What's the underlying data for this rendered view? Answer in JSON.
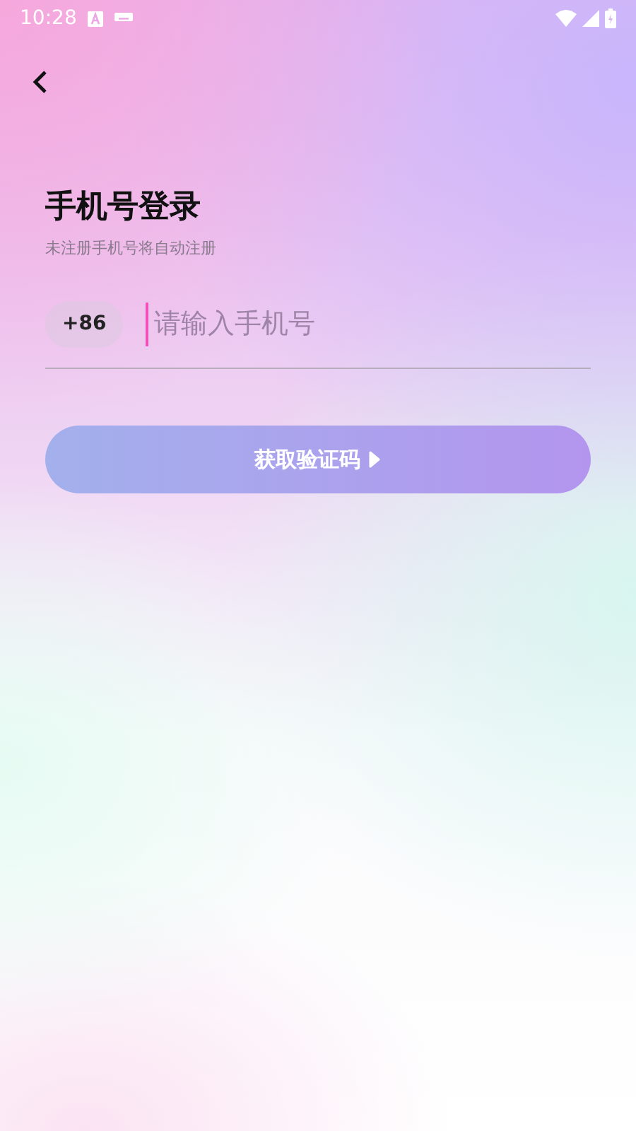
{
  "status_bar": {
    "time": "10:28"
  },
  "title": "手机号登录",
  "subtitle": "未注册手机号将自动注册",
  "phone": {
    "country_code": "+86",
    "placeholder": "请输入手机号"
  },
  "submit": {
    "label": "获取验证码",
    "disabled": true
  }
}
